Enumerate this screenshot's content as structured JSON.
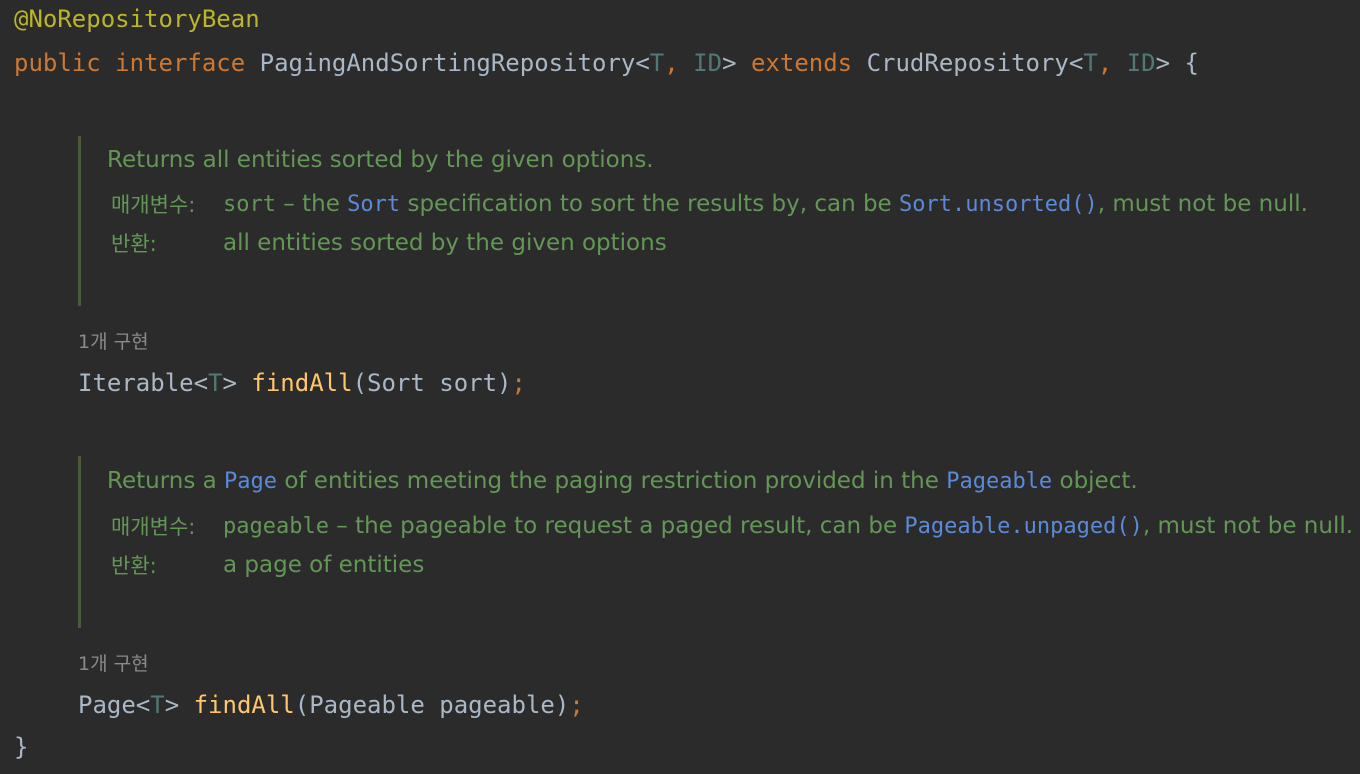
{
  "header": {
    "annotation": "@NoRepositoryBean",
    "kw_public": "public",
    "kw_interface": "interface",
    "name": "PagingAndSortingRepository",
    "lt1": "<",
    "tp_T1": "T",
    "comma1": ", ",
    "tp_ID1": "ID",
    "gt1": ">",
    "kw_extends": "extends",
    "parent": "CrudRepository",
    "lt2": "<",
    "tp_T2": "T",
    "comma2": ", ",
    "tp_ID2": "ID",
    "gt2": ">",
    "brace": "{"
  },
  "doc1": {
    "summary": "Returns all entities sorted by the given options.",
    "param_label": "매개변수:",
    "param_name": "sort",
    "param_text_1": " – the ",
    "param_link_1": "Sort",
    "param_text_2": " specification to sort the results by, can be ",
    "param_link_2": "Sort.unsorted()",
    "param_text_3": ", must not be null.",
    "returns_label": "반환:",
    "returns_text": "all entities sorted by the given options"
  },
  "impl1": "1개 구현",
  "method1": {
    "ret": "Iterable",
    "lt": "<",
    "tparam": "T",
    "gt": ">",
    "name": "findAll",
    "params": "(Sort sort)",
    "semi": ";"
  },
  "doc2": {
    "summary_1": "Returns a ",
    "summary_link_1": "Page",
    "summary_2": " of entities meeting the paging restriction provided in the ",
    "summary_link_2": "Pageable",
    "summary_3": " object.",
    "param_label": "매개변수:",
    "param_name": "pageable",
    "param_text_1": " – the pageable to request a paged result, can be ",
    "param_link_1": "Pageable.unpaged()",
    "param_text_2": ", must not be null.",
    "returns_label": "반환:",
    "returns_text": "a page of entities"
  },
  "impl2": "1개 구현",
  "method2": {
    "ret": "Page",
    "lt": "<",
    "tparam": "T",
    "gt": ">",
    "name": "findAll",
    "params": "(Pageable pageable)",
    "semi": ";"
  },
  "closing_brace": "}"
}
